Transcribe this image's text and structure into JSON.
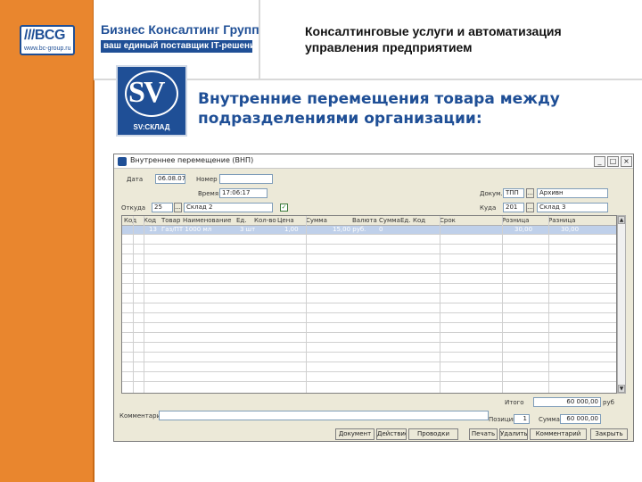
{
  "header": {
    "bcg_mark": "///BCG",
    "bcg_url": "www.bc-group.ru",
    "company_name": "Бизнес Консалтинг Групп",
    "tagline": "ваш единый поставщик IT-решений",
    "title": "Консалтинговые услуги и автоматизация управления предприятием"
  },
  "product_logo": {
    "mark": "SV",
    "caption": "SV:СКЛАД"
  },
  "slide": {
    "title": "Внутренние перемещения товара между подразделениями организации:"
  },
  "window": {
    "title": "Внутреннее перемещение (ВНП)",
    "minimize_glyph": "_",
    "maximize_glyph": "□",
    "close_glyph": "×",
    "form": {
      "date_label": "Дата",
      "date_value": "06.08.07",
      "number_label": "Номер",
      "number_value": "",
      "time_label": "Время",
      "time_value": "17:06:17",
      "from_label": "Откуда",
      "from_code": "25",
      "from_name": "Склад 2",
      "to_label": "Куда",
      "to_code": "201",
      "to_name": "Склад 3",
      "doc_label": "Докум.",
      "doc_code": "ТПП",
      "price_type": "Архивн",
      "lookup_glyph": "...",
      "check_glyph": "✓"
    },
    "grid": {
      "columns": [
        "Код",
        "Код",
        "Товар",
        "Наименование",
        "Ед.",
        "Кол-во",
        "Цена",
        "Сумма",
        "Валюта",
        "Сумма",
        "Ед.",
        "Код",
        "Срок",
        "Розница",
        "Разница"
      ],
      "selected_row": [
        "13",
        "Газ/ПТ 1000 мл",
        "",
        "3 шт",
        "1,00",
        "",
        "15,00 руб.",
        "0",
        "",
        "30,00",
        "30,00"
      ],
      "scroll_up": "▲",
      "scroll_down": "▼"
    },
    "totals": {
      "comment_label": "Комментарий",
      "total_label": "Итого",
      "total_value": "60 000,00",
      "currency": "руб",
      "count_label": "Позиций",
      "count_value": "1",
      "sum_label": "Сумма",
      "sum_value": "60 000,00"
    },
    "buttons": [
      "Документ",
      "Действие",
      "Проводки",
      "Печать",
      "Удалить",
      "Комментарий",
      "Закрыть"
    ]
  }
}
